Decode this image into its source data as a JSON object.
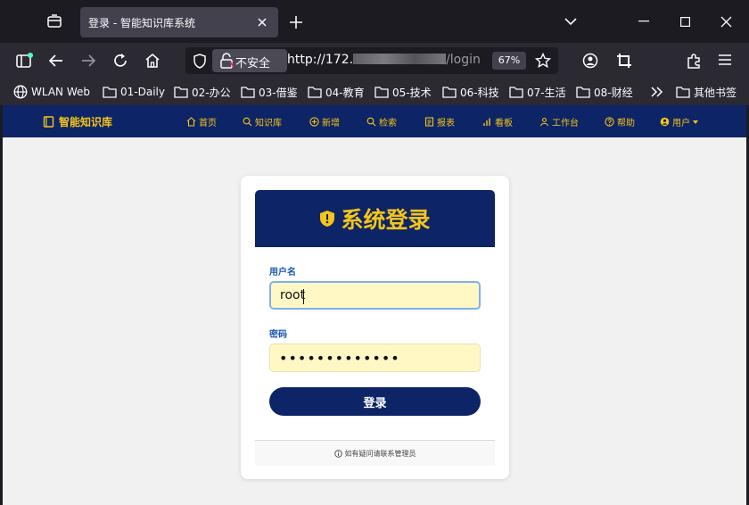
{
  "browser": {
    "tab_title": "登录 - 智能知识库系统",
    "url_security_label": "不安全",
    "url_host": "http://172.",
    "url_path": "/login",
    "zoom_level": "67%",
    "bookmarks": [
      {
        "label": "WLAN Web",
        "icon": "globe-icon"
      },
      {
        "label": "01-Daily",
        "icon": "folder-icon"
      },
      {
        "label": "02-办公",
        "icon": "folder-icon"
      },
      {
        "label": "03-借鉴",
        "icon": "folder-icon"
      },
      {
        "label": "04-教育",
        "icon": "folder-icon"
      },
      {
        "label": "05-技术",
        "icon": "folder-icon"
      },
      {
        "label": "06-科技",
        "icon": "folder-icon"
      },
      {
        "label": "07-生活",
        "icon": "folder-icon"
      },
      {
        "label": "08-财经",
        "icon": "folder-icon"
      }
    ],
    "other_bookmarks": "其他书签"
  },
  "app": {
    "brand": "智能知识库",
    "nav": [
      {
        "label": "首页",
        "icon": "home-icon"
      },
      {
        "label": "知识库",
        "icon": "search-icon"
      },
      {
        "label": "新增",
        "icon": "plus-circle-icon"
      },
      {
        "label": "检索",
        "icon": "search-icon"
      },
      {
        "label": "报表",
        "icon": "report-icon"
      },
      {
        "label": "看板",
        "icon": "bar-chart-icon"
      },
      {
        "label": "工作台",
        "icon": "person-icon"
      },
      {
        "label": "帮助",
        "icon": "help-icon"
      },
      {
        "label": "用户",
        "icon": "user-circle-icon"
      }
    ]
  },
  "login": {
    "title": "系统登录",
    "username_label": "用户名",
    "username_value": "root",
    "password_label": "密码",
    "password_value": "•••••••••••••",
    "submit_label": "登录",
    "footer_note": "如有疑问请联系管理员"
  },
  "colors": {
    "brand_navy": "#0d2466",
    "accent_gold": "#f5c518",
    "input_bg": "#fff8c5",
    "label_blue": "#1a56b4"
  }
}
